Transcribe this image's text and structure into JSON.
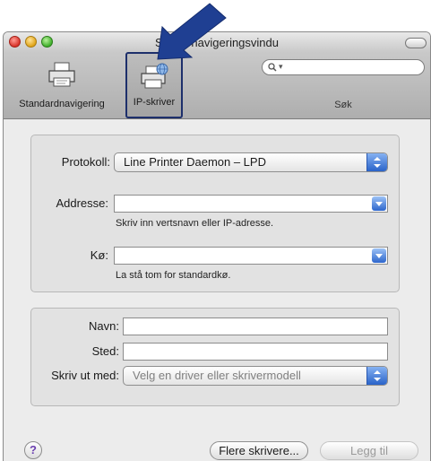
{
  "window": {
    "title": "Skrivernavigeringsvindu"
  },
  "toolbar": {
    "standard_label": "Standardnavigering",
    "ip_label": "IP-skriver",
    "search_label": "Søk",
    "search_placeholder": ""
  },
  "form": {
    "protocol_label": "Protokoll:",
    "protocol_value": "Line Printer Daemon – LPD",
    "address_label": "Addresse:",
    "address_value": "",
    "address_hint": "Skriv inn vertsnavn eller IP-adresse.",
    "queue_label": "Kø:",
    "queue_value": "",
    "queue_hint": "La stå tom for standardkø.",
    "name_label": "Navn:",
    "name_value": "",
    "location_label": "Sted:",
    "location_value": "",
    "print_using_label": "Skriv ut med:",
    "print_using_value": "Velg en driver eller skrivermodell"
  },
  "buttons": {
    "help": "?",
    "more_printers": "Flere skrivere...",
    "add": "Legg til"
  },
  "colors": {
    "annotation_arrow": "#1f3f92",
    "selection_border": "#1d2f6b",
    "popup_accent": "#2a63c9"
  }
}
